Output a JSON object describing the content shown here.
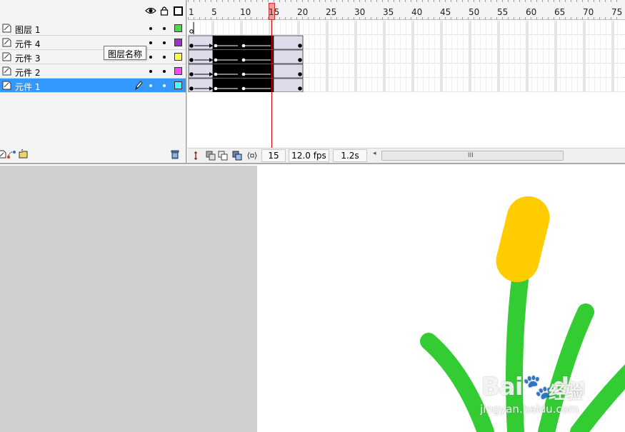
{
  "timeline": {
    "header_icons": [
      "eye-icon",
      "lock-icon",
      "outline-icon"
    ],
    "tooltip": "图层名称",
    "layers": [
      {
        "name": "图层 1",
        "color": "#44dd44",
        "selected": false
      },
      {
        "name": "元件 4",
        "color": "#9933cc",
        "selected": false
      },
      {
        "name": "元件 3",
        "color": "#ffff44",
        "selected": false
      },
      {
        "name": "元件 2",
        "color": "#ff44ff",
        "selected": false
      },
      {
        "name": "元件 1",
        "color": "#44ffff",
        "selected": true
      }
    ],
    "ruler_numbers": [
      "1",
      "5",
      "10",
      "15",
      "20",
      "25",
      "30",
      "35",
      "40",
      "45",
      "50",
      "55",
      "60",
      "65",
      "70",
      "75"
    ],
    "current_frame_marker": "15",
    "status": {
      "current_frame": "15",
      "fps": "12.0 fps",
      "elapsed": "1.2s"
    },
    "scroll_grip": "III",
    "scroll_left_arrow": "◂"
  },
  "stage": {
    "watermark_brand": "Bai",
    "watermark_paw": "du",
    "watermark_sub": "经验",
    "watermark_url": "jingyan.baidu.com",
    "colors": {
      "stem": "#33cc33",
      "head": "#ffcc00",
      "pasteboard": "#d0d0d0",
      "selection": "#3399ff"
    }
  }
}
